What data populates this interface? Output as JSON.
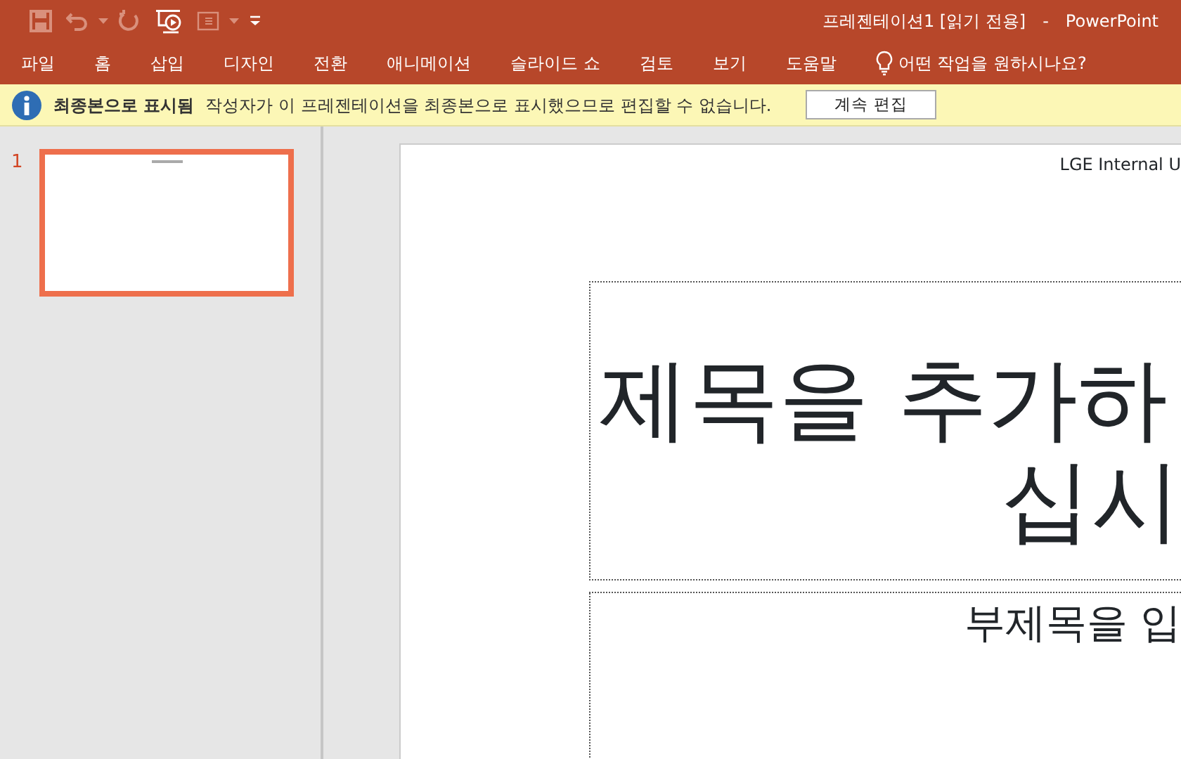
{
  "window": {
    "title": "프레젠테이션1 [읽기 전용]",
    "separator": "-",
    "app": "PowerPoint"
  },
  "quick_access": [
    {
      "kind": "save",
      "disabled": true
    },
    {
      "kind": "undo",
      "disabled": true
    },
    {
      "kind": "caret",
      "disabled": true
    },
    {
      "kind": "redo",
      "disabled": true
    },
    {
      "kind": "present",
      "disabled": false
    },
    {
      "kind": "layout",
      "disabled": true
    },
    {
      "kind": "caret",
      "disabled": true
    },
    {
      "kind": "customize",
      "disabled": false
    }
  ],
  "ribbon_tabs": [
    {
      "label": "파일"
    },
    {
      "label": "홈"
    },
    {
      "label": "삽입"
    },
    {
      "label": "디자인"
    },
    {
      "label": "전환"
    },
    {
      "label": "애니메이션"
    },
    {
      "label": "슬라이드 쇼"
    },
    {
      "label": "검토"
    },
    {
      "label": "보기"
    },
    {
      "label": "도움말"
    }
  ],
  "tell_me": "어떤 작업을 원하시나요?",
  "message_bar": {
    "title": "최종본으로 표시됨",
    "text": "작성자가 이 프레젠테이션을 최종본으로 표시했으므로 편집할 수 없습니다.",
    "button": "계속 편집"
  },
  "thumbnails": [
    {
      "number": "1",
      "selected": true
    }
  ],
  "slide": {
    "header": "LGE Internal U",
    "title_lines": [
      "제목을 추가하",
      "십시"
    ],
    "subtitle": "부제목을 입"
  }
}
